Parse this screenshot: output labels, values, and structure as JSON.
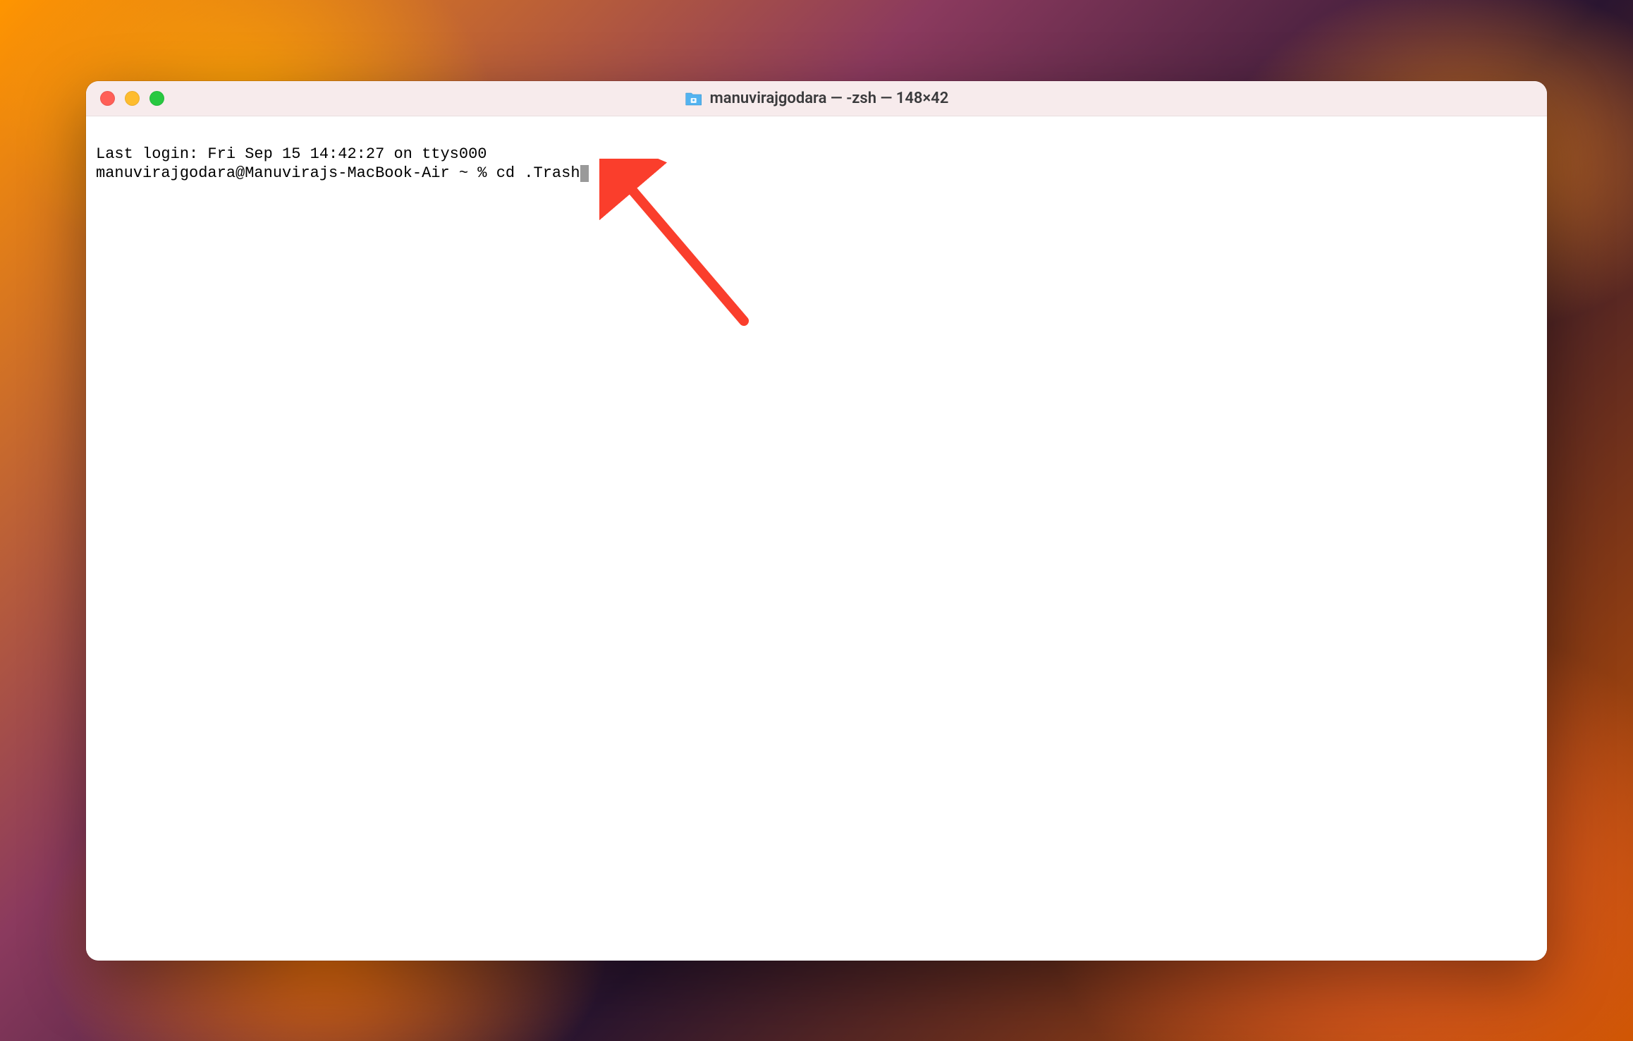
{
  "window": {
    "title": "manuvirajgodara — -zsh — 148×42"
  },
  "terminal": {
    "last_login_line": "Last login: Fri Sep 15 14:42:27 on ttys000",
    "prompt": "manuvirajgodara@Manuvirajs-MacBook-Air ~ % ",
    "command": "cd .Trash"
  },
  "traffic_lights": {
    "close": "close",
    "minimize": "minimize",
    "maximize": "maximize"
  },
  "annotation": {
    "type": "arrow",
    "color": "#fa3e2c"
  }
}
